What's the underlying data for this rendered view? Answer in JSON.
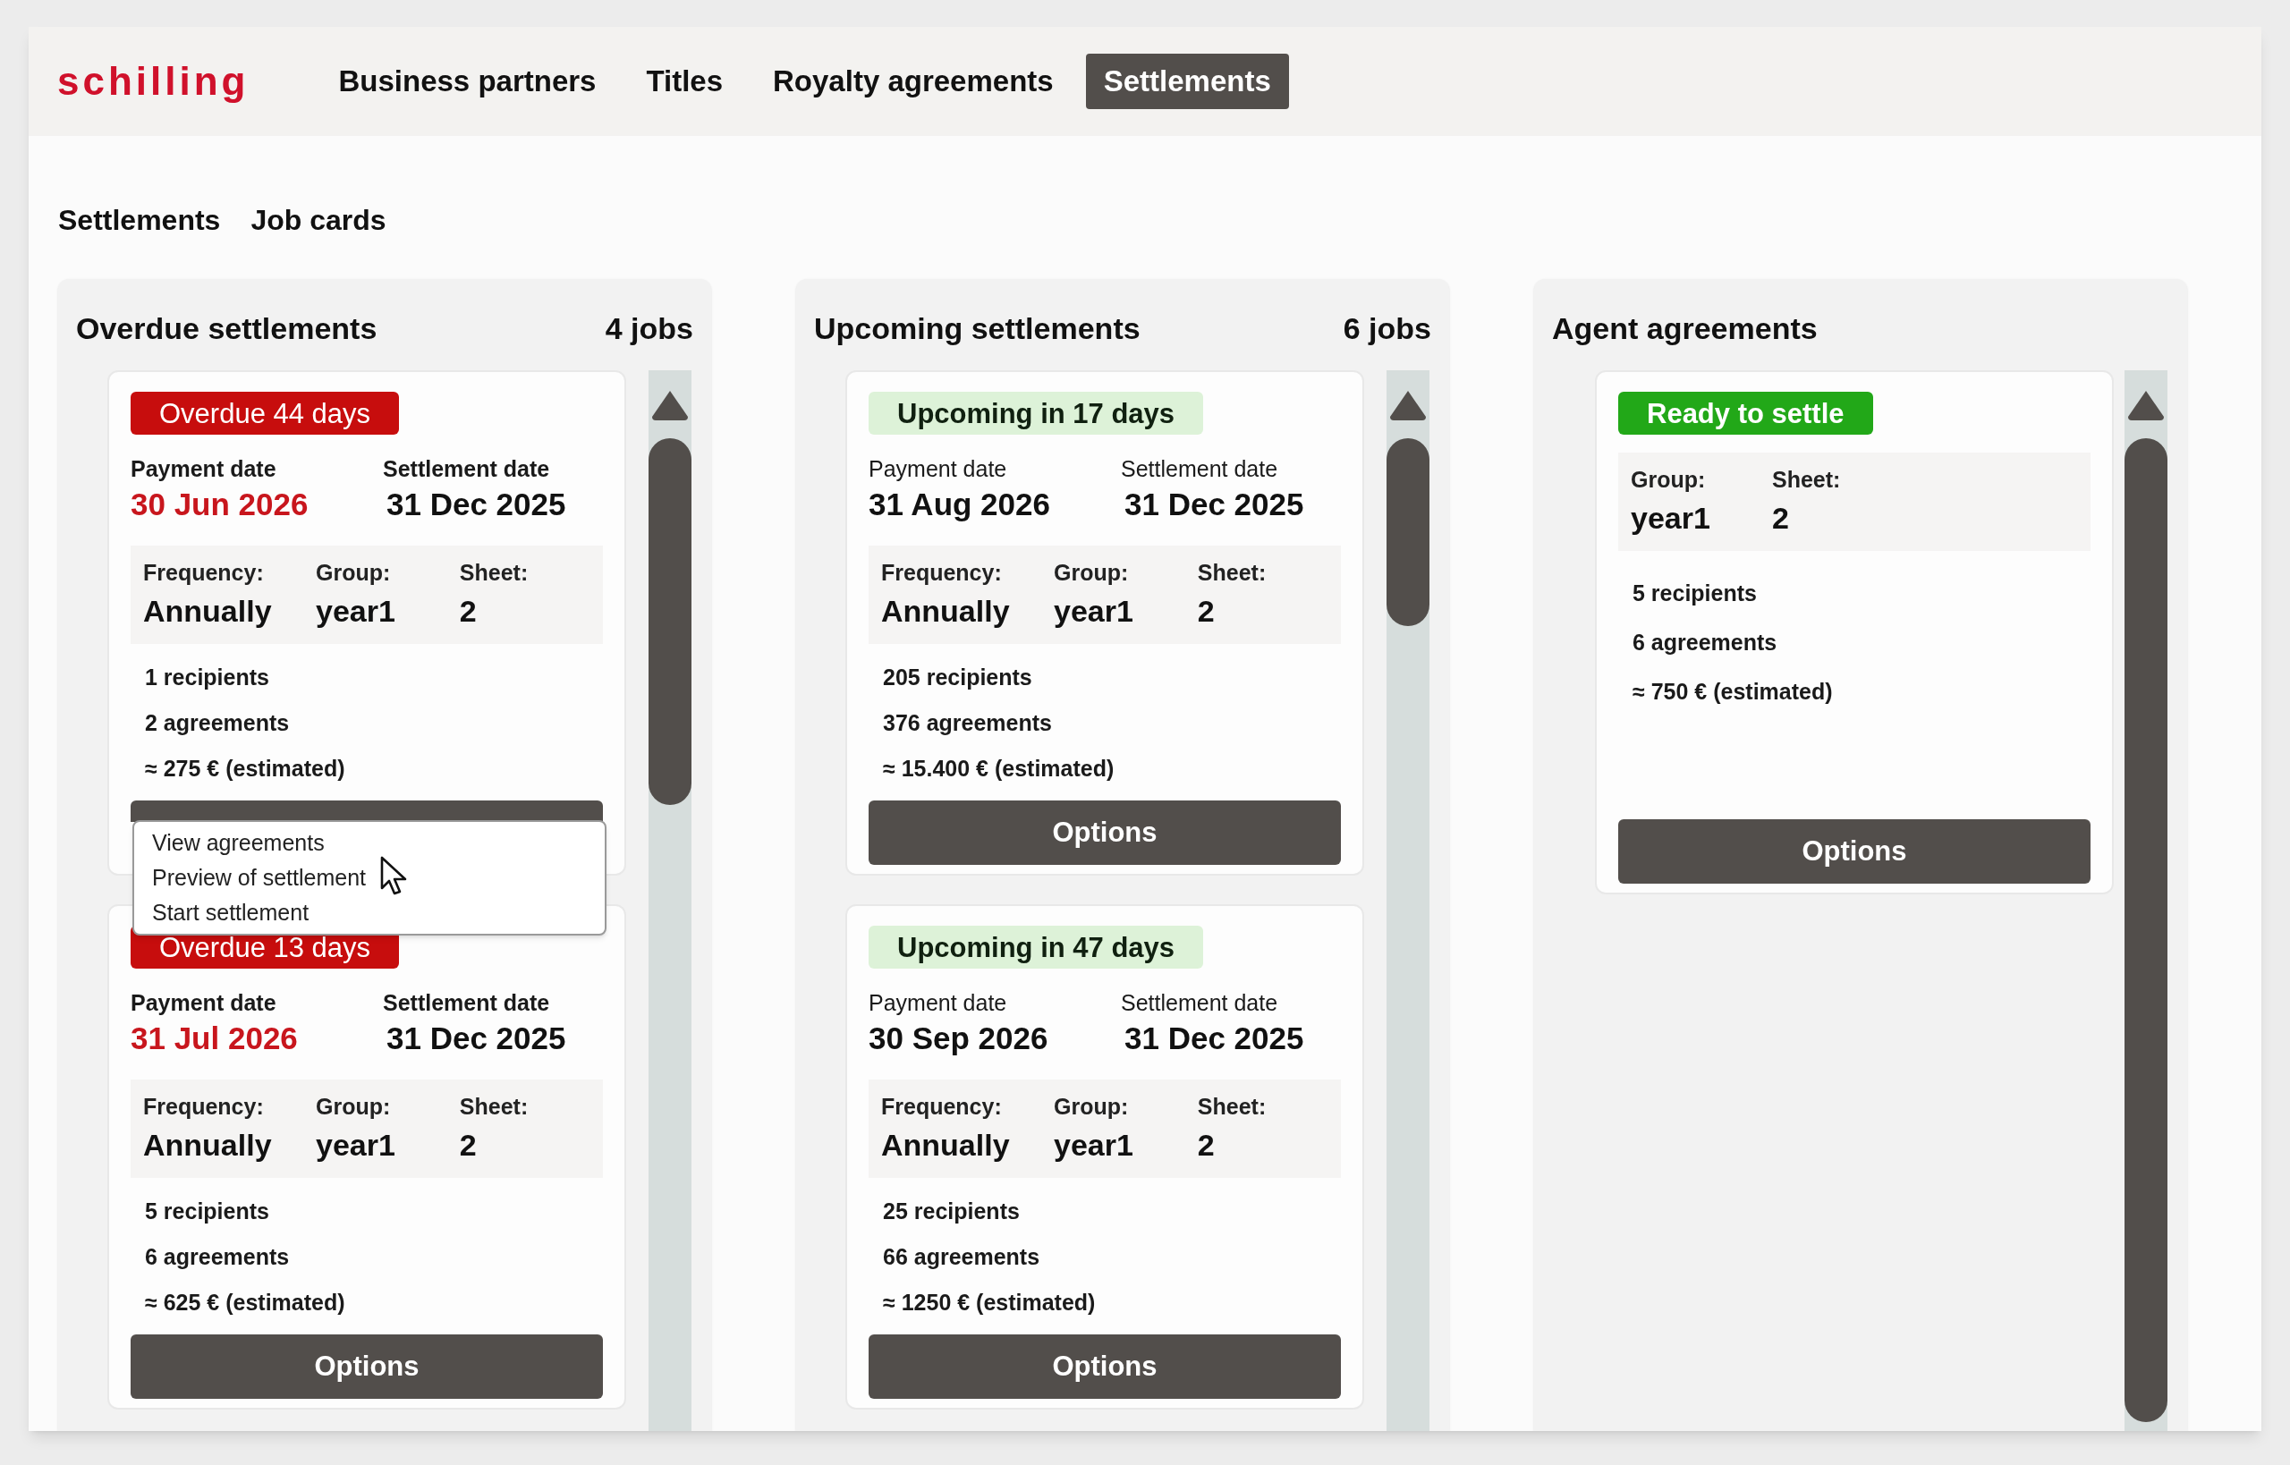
{
  "header": {
    "logo": "schilling",
    "nav": [
      {
        "label": "Business partners",
        "selected": false
      },
      {
        "label": "Titles",
        "selected": false
      },
      {
        "label": "Royalty agreements",
        "selected": false
      },
      {
        "label": "Settlements",
        "selected": true
      }
    ]
  },
  "subnav": [
    "Settlements",
    "Job cards"
  ],
  "columns": [
    {
      "title": "Overdue settlements",
      "count": "4 jobs",
      "cards": [
        {
          "badge": {
            "kind": "overdue",
            "text": "Overdue 44 days"
          },
          "dates": [
            {
              "label": "Payment date",
              "value": "30 Jun 2026"
            },
            {
              "label": "Settlement date",
              "value": "31 Dec 2025"
            }
          ],
          "fields": [
            {
              "label": "Frequency:",
              "value": "Annually"
            },
            {
              "label": "Group:",
              "value": "year1"
            },
            {
              "label": "Sheet:",
              "value": "2"
            }
          ],
          "stats": [
            "1 recipients",
            "2 agreements",
            "≈ 275 € (estimated)"
          ],
          "menu": [
            "View agreements",
            "Preview of settlement",
            "Start settlement"
          ]
        },
        {
          "badge": {
            "kind": "overdue",
            "text": "Overdue 13 days"
          },
          "dates": [
            {
              "label": "Payment date",
              "value": "31 Jul 2026"
            },
            {
              "label": "Settlement date",
              "value": "31 Dec 2025"
            }
          ],
          "fields": [
            {
              "label": "Frequency:",
              "value": "Annually"
            },
            {
              "label": "Group:",
              "value": "year1"
            },
            {
              "label": "Sheet:",
              "value": "2"
            }
          ],
          "stats": [
            "5 recipients",
            "6 agreements",
            "≈ 625 € (estimated)"
          ],
          "button": "Options"
        }
      ]
    },
    {
      "title": "Upcoming settlements",
      "count": "6 jobs",
      "cards": [
        {
          "badge": {
            "kind": "upcoming",
            "text": "Upcoming in 17 days"
          },
          "dates": [
            {
              "label": "Payment date",
              "value": "31 Aug 2026"
            },
            {
              "label": "Settlement date",
              "value": "31 Dec 2025"
            }
          ],
          "fields": [
            {
              "label": "Frequency:",
              "value": "Annually"
            },
            {
              "label": "Group:",
              "value": "year1"
            },
            {
              "label": "Sheet:",
              "value": "2"
            }
          ],
          "stats": [
            "205 recipients",
            "376 agreements",
            "≈ 15.400 € (estimated)"
          ],
          "button": "Options"
        },
        {
          "badge": {
            "kind": "upcoming",
            "text": "Upcoming in 47 days"
          },
          "dates": [
            {
              "label": "Payment date",
              "value": "30 Sep 2026"
            },
            {
              "label": "Settlement date",
              "value": "31 Dec 2025"
            }
          ],
          "fields": [
            {
              "label": "Frequency:",
              "value": "Annually"
            },
            {
              "label": "Group:",
              "value": "year1"
            },
            {
              "label": "Sheet:",
              "value": "2"
            }
          ],
          "stats": [
            "25 recipients",
            "66 agreements",
            "≈ 1250 € (estimated)"
          ],
          "button": "Options"
        }
      ]
    },
    {
      "title": "Agent agreements",
      "cards": [
        {
          "badge": {
            "kind": "ready",
            "text": "Ready to settle"
          },
          "fields": [
            {
              "label": "Group:",
              "value": "year1"
            },
            {
              "label": "Sheet:",
              "value": "2"
            }
          ],
          "stats": [
            "5 recipients",
            "6 agreements",
            "≈ 750 € (estimated)"
          ],
          "button": "Options"
        }
      ]
    }
  ]
}
